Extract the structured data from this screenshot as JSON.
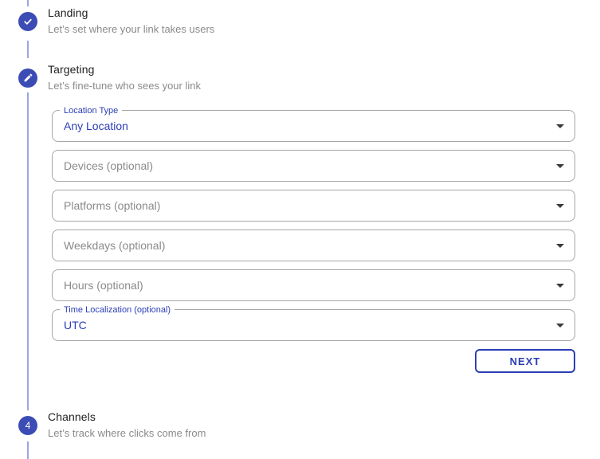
{
  "stepper": {
    "steps": [
      {
        "title": "Landing",
        "description": "Let’s set where your link takes users",
        "icon": "check-icon",
        "state": "completed"
      },
      {
        "title": "Targeting",
        "description": "Let’s fine-tune who sees your link",
        "icon": "pencil-icon",
        "state": "active"
      },
      {
        "title": "Channels",
        "description": "Let’s track where clicks come from",
        "icon": "step-number",
        "number": "4",
        "state": "upcoming"
      }
    ]
  },
  "form": {
    "location_type": {
      "label": "Location Type",
      "value": "Any Location"
    },
    "devices": {
      "placeholder": "Devices (optional)"
    },
    "platforms": {
      "placeholder": "Platforms (optional)"
    },
    "weekdays": {
      "placeholder": "Weekdays (optional)"
    },
    "hours": {
      "placeholder": "Hours (optional)"
    },
    "time_localization": {
      "label": "Time Localization (optional)",
      "value": "UTC"
    },
    "next_label": "NEXT"
  },
  "colors": {
    "step_circle": "#3c4cb5",
    "accent_text": "#2b3eb5",
    "connector": "#9aa5e5",
    "field_border": "#a6a6a6",
    "muted_text": "#8a8a8a",
    "title_text": "#1f1f1f",
    "arrow": "#3a3a3a"
  }
}
